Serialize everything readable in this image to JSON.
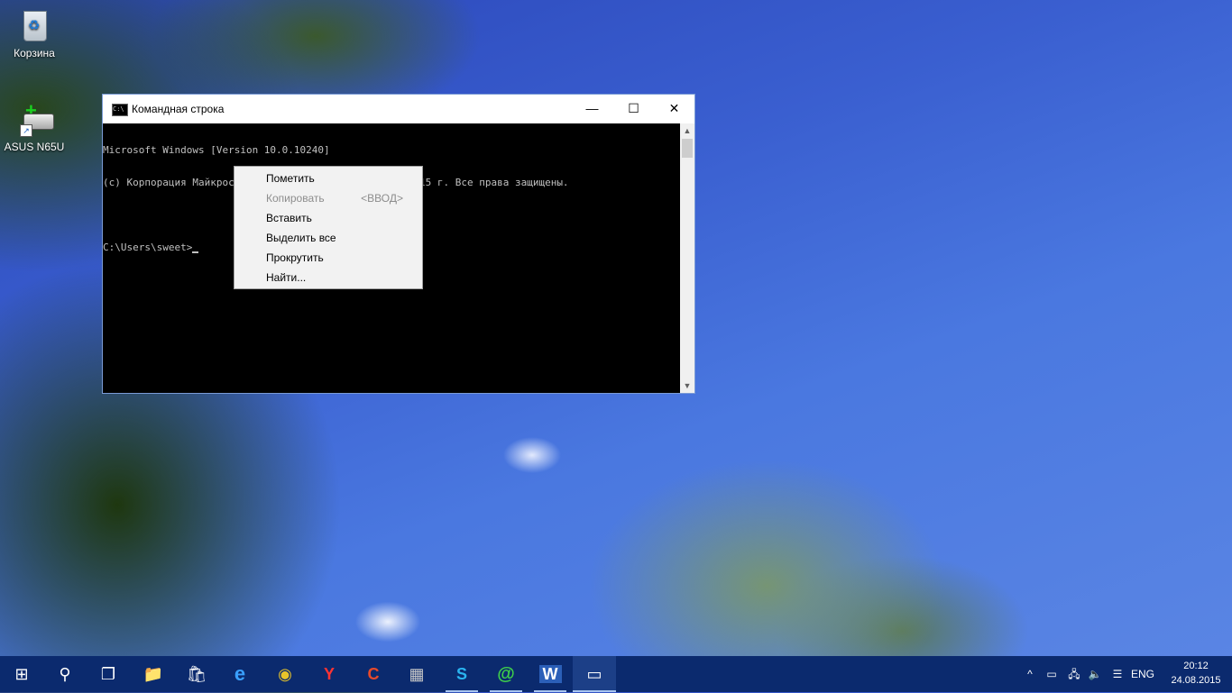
{
  "desktop": {
    "icons": [
      {
        "label": "Корзина",
        "icon": "recycle-bin-icon"
      },
      {
        "label": "ASUS N65U",
        "icon": "network-drive-icon"
      }
    ]
  },
  "console": {
    "title": "Командная строка",
    "icon": "cmd-icon",
    "buttons": {
      "minimize": "—",
      "maximize": "☐",
      "close": "✕"
    },
    "lines": [
      "Microsoft Windows [Version 10.0.10240]",
      "(c) Корпорация Майкрософт (Microsoft Corporation), 2015 г. Все права защищены.",
      "",
      "C:\\Users\\sweet>"
    ],
    "scroll_up": "▲",
    "scroll_down": "▼"
  },
  "context_menu": {
    "items": [
      {
        "label": "Пометить",
        "enabled": true,
        "shortcut": ""
      },
      {
        "label": "Копировать",
        "enabled": false,
        "shortcut": "<ВВОД>"
      },
      {
        "label": "Вставить",
        "enabled": true,
        "shortcut": ""
      },
      {
        "label": "Выделить все",
        "enabled": true,
        "shortcut": ""
      },
      {
        "label": "Прокрутить",
        "enabled": true,
        "shortcut": ""
      },
      {
        "label": "Найти...",
        "enabled": true,
        "shortcut": ""
      }
    ]
  },
  "taskbar": {
    "buttons": [
      {
        "name": "start-icon",
        "glyph": "⊞"
      },
      {
        "name": "search-icon",
        "glyph": "⚲"
      },
      {
        "name": "task-view-icon",
        "glyph": "❐"
      },
      {
        "name": "file-explorer-icon",
        "glyph": "📁"
      },
      {
        "name": "store-icon",
        "glyph": "🛍"
      },
      {
        "name": "edge-icon",
        "glyph": "e"
      },
      {
        "name": "chrome-icon",
        "glyph": "◉"
      },
      {
        "name": "yandex-icon",
        "glyph": "Y"
      },
      {
        "name": "ccleaner-icon",
        "glyph": "C"
      },
      {
        "name": "firewall-icon",
        "glyph": "▦"
      },
      {
        "name": "skype-icon",
        "glyph": "S"
      },
      {
        "name": "mail-agent-icon",
        "glyph": "@"
      },
      {
        "name": "word-icon",
        "glyph": "W"
      },
      {
        "name": "cmd-icon",
        "glyph": "▭",
        "active": true
      }
    ],
    "tray": {
      "chevron": "^",
      "battery": "▭",
      "network": "🖧",
      "volume": "🔈",
      "notifications": "☰",
      "language": "ENG"
    },
    "time": "20:12",
    "date": "24.08.2015"
  },
  "colors": {
    "taskbar": "#0b2a6e",
    "console_bg": "#000000",
    "console_text": "#c0c0c0",
    "menu_bg": "#f2f2f2",
    "disabled_text": "#8d8d8d"
  }
}
